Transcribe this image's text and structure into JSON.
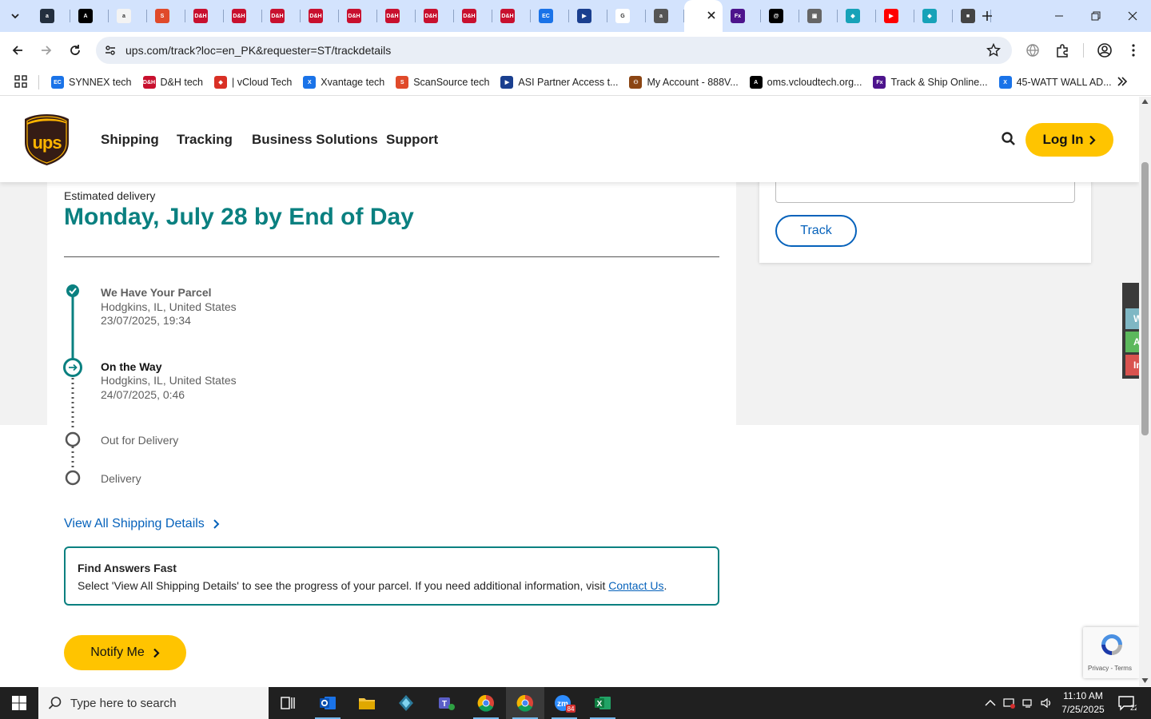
{
  "browser": {
    "active_tab_title": "UPS",
    "tabs": [
      {
        "icon": "amazon-icon",
        "color": "#232f3e",
        "label": "a"
      },
      {
        "icon": "circle-a-icon",
        "color": "#000000",
        "label": "A"
      },
      {
        "icon": "amazon-icon",
        "color": "#f3f3f3",
        "label": "a"
      },
      {
        "icon": "scansource-icon",
        "color": "#e04a2a",
        "label": "S"
      },
      {
        "icon": "dh-icon",
        "color": "#c8102e",
        "label": "D&H"
      },
      {
        "icon": "dh-icon",
        "color": "#c8102e",
        "label": "D&H"
      },
      {
        "icon": "dh-icon",
        "color": "#c8102e",
        "label": "D&H"
      },
      {
        "icon": "dh-icon",
        "color": "#c8102e",
        "label": "D&H"
      },
      {
        "icon": "dh-icon",
        "color": "#c8102e",
        "label": "D&H"
      },
      {
        "icon": "dh-icon",
        "color": "#c8102e",
        "label": "D&H"
      },
      {
        "icon": "dh-icon",
        "color": "#c8102e",
        "label": "D&H"
      },
      {
        "icon": "dh-icon",
        "color": "#c8102e",
        "label": "D&H"
      },
      {
        "icon": "dh-icon",
        "color": "#c8102e",
        "label": "D&H"
      },
      {
        "icon": "ec-icon",
        "color": "#1a73e8",
        "label": "EC"
      },
      {
        "icon": "asi-icon",
        "color": "#1a3f8f",
        "label": "▶"
      },
      {
        "icon": "google-icon",
        "color": "#ffffff",
        "label": "G"
      },
      {
        "icon": "amazon-icon",
        "color": "#555555",
        "label": "a"
      },
      {
        "icon": "ups-icon",
        "color": "#ffffff",
        "label": ""
      },
      {
        "icon": "fedex-icon",
        "color": "#4d148c",
        "label": "Fx"
      },
      {
        "icon": "threads-icon",
        "color": "#000000",
        "label": "@"
      },
      {
        "icon": "truck-icon",
        "color": "#666666",
        "label": "▣"
      },
      {
        "icon": "hex-icon",
        "color": "#17a2b8",
        "label": "◆"
      },
      {
        "icon": "youtube-icon",
        "color": "#ff0000",
        "label": "▶"
      },
      {
        "icon": "hex-icon",
        "color": "#17a2b8",
        "label": "◆"
      },
      {
        "icon": "media-icon",
        "color": "#444444",
        "label": "■"
      }
    ],
    "url": "ups.com/track?loc=en_PK&requester=ST/trackdetails",
    "bookmarks": [
      {
        "label": "SYNNEX tech",
        "icon": "ec-icon",
        "color": "#1a73e8",
        "glyph": "EC"
      },
      {
        "label": "D&H tech",
        "icon": "dh-icon",
        "color": "#c8102e",
        "glyph": "D&H"
      },
      {
        "label": "| vCloud Tech",
        "icon": "tag-icon",
        "color": "#d93025",
        "glyph": "◆"
      },
      {
        "label": "Xvantage tech",
        "icon": "xvantage-icon",
        "color": "#1a73e8",
        "glyph": "X"
      },
      {
        "label": "ScanSource tech",
        "icon": "scansource-icon",
        "color": "#e04a2a",
        "glyph": "S"
      },
      {
        "label": "ASI Partner Access t...",
        "icon": "asi-icon",
        "color": "#1a3f8f",
        "glyph": "▶"
      },
      {
        "label": "My Account - 888V...",
        "icon": "account-icon",
        "color": "#8b4513",
        "glyph": "⚇"
      },
      {
        "label": "oms.vcloudtech.org...",
        "icon": "circle-a-icon",
        "color": "#000000",
        "glyph": "A"
      },
      {
        "label": "Track & Ship Online...",
        "icon": "fedex-icon",
        "color": "#4d148c",
        "glyph": "Fx"
      },
      {
        "label": "45-WATT WALL AD...",
        "icon": "xvantage-icon",
        "color": "#1a73e8",
        "glyph": "X"
      }
    ]
  },
  "ups": {
    "nav": [
      "Shipping",
      "Tracking",
      "Business Solutions",
      "Support"
    ],
    "login_label": "Log In",
    "track_button": "Track",
    "estimated_label": "Estimated delivery",
    "estimated_date": "Monday, July 28 by End of Day",
    "steps": [
      {
        "title": "We Have Your Parcel",
        "location": "Hodgkins, IL, United States",
        "time": "23/07/2025, 19:34",
        "status": "done"
      },
      {
        "title": "On the Way",
        "location": "Hodgkins, IL, United States",
        "time": "24/07/2025, 0:46",
        "status": "current"
      },
      {
        "title": "Out for Delivery",
        "status": "pending"
      },
      {
        "title": "Delivery",
        "status": "pending"
      }
    ],
    "view_all_label": "View All Shipping Details",
    "find_answers": {
      "title": "Find Answers Fast",
      "text": "Select 'View All Shipping Details' to see the progress of your parcel. If you need additional information, visit ",
      "link": "Contact Us",
      "suffix": "."
    },
    "notify_label": "Notify Me",
    "feedback_tabs": [
      {
        "label": "Wo",
        "color": "#7fb7c4"
      },
      {
        "label": "Acti",
        "color": "#5cb85c"
      },
      {
        "label": "In A",
        "color": "#d9534f"
      }
    ],
    "recaptcha_text": "Privacy - Terms",
    "colors": {
      "teal": "#0a8080",
      "gold": "#ffc400",
      "blue": "#0662bb",
      "brown": "#351c15"
    }
  },
  "taskbar": {
    "search_placeholder": "Type here to search",
    "time": "11:10 AM",
    "date": "7/25/2025",
    "notification_count": "22",
    "zoom_badge": "84"
  }
}
